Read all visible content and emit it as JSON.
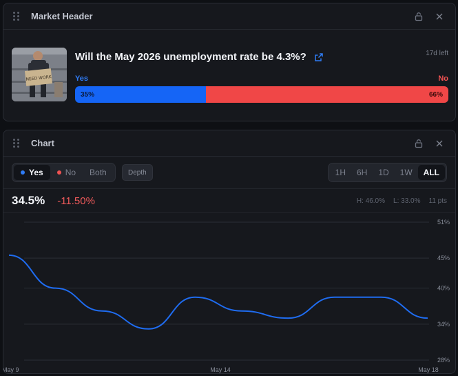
{
  "market_panel": {
    "title": "Market Header",
    "question": "Will the May 2026 unemployment rate be 4.3%?",
    "time_left": "17d left",
    "yes_label": "Yes",
    "no_label": "No",
    "yes_pct": "35%",
    "no_pct": "66%",
    "yes_fraction": 0.35,
    "image_text": "NEED WORK"
  },
  "chart_panel": {
    "title": "Chart",
    "outcomes": [
      {
        "label": "Yes",
        "dot_color": "#2f7cf6",
        "active": true
      },
      {
        "label": "No",
        "dot_color": "#f05252",
        "active": false
      },
      {
        "label": "Both",
        "dot_color": "",
        "active": false
      }
    ],
    "depth_label": "Depth",
    "ranges": [
      {
        "label": "1H",
        "active": false
      },
      {
        "label": "6H",
        "active": false
      },
      {
        "label": "1D",
        "active": false
      },
      {
        "label": "1W",
        "active": false
      },
      {
        "label": "ALL",
        "active": true
      }
    ],
    "price": "34.5%",
    "change": "-11.50%",
    "high": "H: 46.0%",
    "low": "L: 33.0%",
    "points": "11 pts"
  },
  "colors": {
    "accent_yes": "#1565f6",
    "accent_no": "#f04747",
    "line": "#1f6cf0"
  },
  "chart_data": {
    "type": "line",
    "x_tick_labels": [
      "May 9",
      "May 14",
      "May 18"
    ],
    "y_tick_labels": [
      "51%",
      "45%",
      "40%",
      "34%",
      "28%"
    ],
    "ylim": [
      28,
      51
    ],
    "grid": true,
    "series": [
      {
        "x": [
          "May 9",
          "May 10",
          "May 11",
          "May 12",
          "May 13",
          "May 14",
          "May 15",
          "May 16",
          "May 17",
          "May 18"
        ],
        "values": [
          45.5,
          40.0,
          36.2,
          33.2,
          38.5,
          36.2,
          35.0,
          38.5,
          38.5,
          35.0
        ]
      }
    ]
  }
}
